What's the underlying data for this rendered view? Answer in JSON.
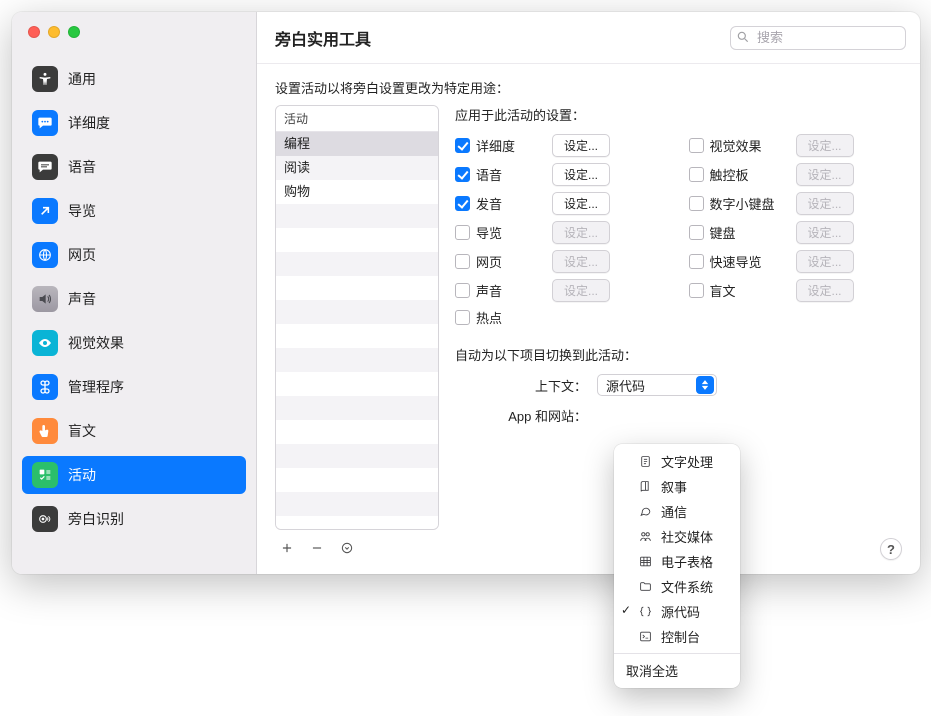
{
  "window_title": "旁白实用工具",
  "search_placeholder": "搜索",
  "sidebar": {
    "items": [
      {
        "label": "通用"
      },
      {
        "label": "详细度"
      },
      {
        "label": "语音"
      },
      {
        "label": "导览"
      },
      {
        "label": "网页"
      },
      {
        "label": "声音"
      },
      {
        "label": "视觉效果"
      },
      {
        "label": "管理程序"
      },
      {
        "label": "盲文"
      },
      {
        "label": "活动"
      },
      {
        "label": "旁白识别"
      }
    ],
    "selected_index": 9
  },
  "intro": "设置活动以将旁白设置更改为特定用途：",
  "activities": {
    "header": "活动",
    "items": [
      "编程",
      "阅读",
      "购物"
    ],
    "selected_index": 0
  },
  "settings_header": "应用于此活动的设置：",
  "set_button": "设定...",
  "options_left": [
    {
      "label": "详细度",
      "checked": true,
      "enabled": true
    },
    {
      "label": "语音",
      "checked": true,
      "enabled": true
    },
    {
      "label": "发音",
      "checked": true,
      "enabled": true
    },
    {
      "label": "导览",
      "checked": false,
      "enabled": false
    },
    {
      "label": "网页",
      "checked": false,
      "enabled": false
    },
    {
      "label": "声音",
      "checked": false,
      "enabled": false
    },
    {
      "label": "热点",
      "checked": false,
      "enabled": false,
      "no_button": true
    }
  ],
  "options_right": [
    {
      "label": "视觉效果",
      "checked": false,
      "enabled": false
    },
    {
      "label": "触控板",
      "checked": false,
      "enabled": false
    },
    {
      "label": "数字小键盘",
      "checked": false,
      "enabled": false
    },
    {
      "label": "键盘",
      "checked": false,
      "enabled": false
    },
    {
      "label": "快速导览",
      "checked": false,
      "enabled": false
    },
    {
      "label": "盲文",
      "checked": false,
      "enabled": false
    }
  ],
  "auto_switch_header": "自动为以下项目切换到此活动：",
  "context_label": "上下文：",
  "context_value": "源代码",
  "app_label": "App 和网站：",
  "dropdown": {
    "items": [
      "文字处理",
      "叙事",
      "通信",
      "社交媒体",
      "电子表格",
      "文件系统",
      "源代码",
      "控制台"
    ],
    "checked_index": 6,
    "footer": "取消全选"
  },
  "help": "?"
}
